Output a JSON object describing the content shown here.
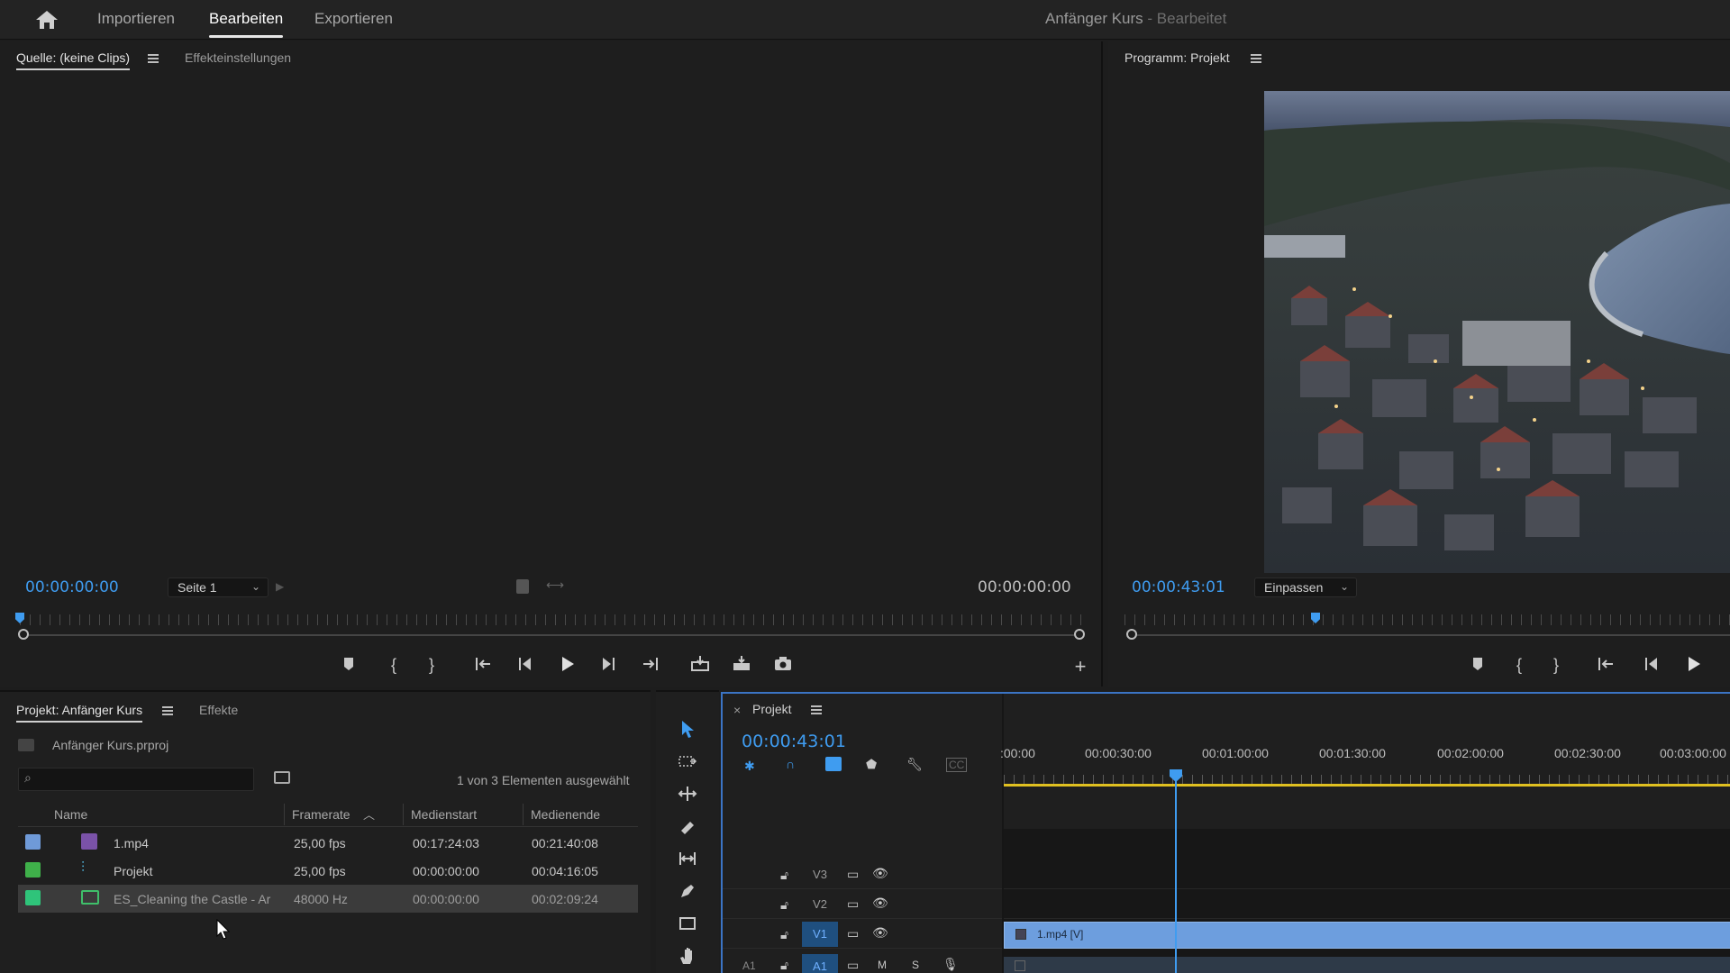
{
  "header": {
    "tabs": [
      {
        "label": "Importieren",
        "active": false
      },
      {
        "label": "Bearbeiten",
        "active": true
      },
      {
        "label": "Exportieren",
        "active": false
      }
    ],
    "project_title": "Anfänger Kurs",
    "project_status": "- Bearbeitet"
  },
  "source_panel": {
    "tab_active": "Quelle: (keine Clips)",
    "tab_other": "Effekteinstellungen",
    "timecode_left": "00:00:00:00",
    "timecode_right": "00:00:00:00",
    "page_dropdown": "Seite 1"
  },
  "program_panel": {
    "tab": "Programm: Projekt",
    "timecode": "00:00:43:01",
    "fit_dropdown": "Einpassen"
  },
  "project_panel": {
    "tab_active": "Projekt: Anfänger Kurs",
    "tab_other": "Effekte",
    "file_name": "Anfänger Kurs.prproj",
    "search_placeholder": "",
    "selection_status": "1 von 3 Elementen ausgewählt",
    "columns": [
      "Name",
      "Framerate",
      "Medienstart",
      "Medienende"
    ],
    "items": [
      {
        "name": "1.mp4",
        "framerate": "25,00 fps",
        "start": "00:17:24:03",
        "end": "00:21:40:08",
        "color": "#6f9ad8",
        "icon": "video-clip-icon"
      },
      {
        "name": "Projekt",
        "framerate": "25,00 fps",
        "start": "00:00:00:00",
        "end": "00:04:16:05",
        "color": "#3fb04a",
        "icon": "sequence-icon"
      },
      {
        "name": "ES_Cleaning the Castle - Ar",
        "framerate": "48000  Hz",
        "start": "00:00:00:00",
        "end": "00:02:09:24",
        "color": "#2fc47a",
        "icon": "audio-clip-icon"
      }
    ]
  },
  "timeline": {
    "tab": "Projekt",
    "timecode": "00:00:43:01",
    "ruler_labels": [
      ":00:00",
      "00:00:30:00",
      "00:01:00:00",
      "00:01:30:00",
      "00:02:00:00",
      "00:02:30:00",
      "00:03:00:00"
    ],
    "tracks": [
      {
        "label": "V3",
        "on": false
      },
      {
        "label": "V2",
        "on": false
      },
      {
        "label": "V1",
        "on": true
      }
    ],
    "audio_track": {
      "label_left": "A1",
      "label": "A1",
      "m": "M",
      "s": "S"
    },
    "clip_label": "1.mp4 [V]"
  },
  "colors": {
    "accent": "#3f9cf0",
    "clip": "#6d9ede",
    "timeline_work_area": "#e0c020"
  }
}
